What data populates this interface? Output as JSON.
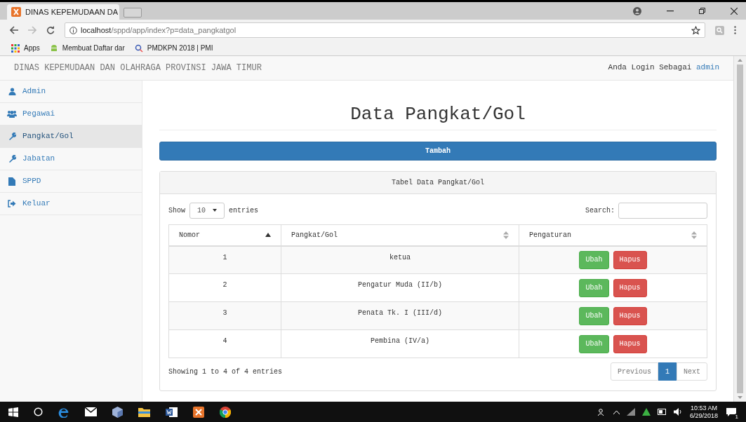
{
  "browser": {
    "tab_title": "DINAS KEPEMUDAAN DA",
    "url_host": "localhost",
    "url_path": "/sppd/app/index?p=data_pangkatgol",
    "bookmarks": [
      {
        "label": "Apps"
      },
      {
        "label": "Membuat Daftar dar"
      },
      {
        "label": "PMDKPN 2018 | PMI"
      }
    ]
  },
  "header": {
    "title": "DINAS KEPEMUDAAN DAN OLAHRAGA PROVINSI JAWA TIMUR",
    "login_text": "Anda Login Sebagai",
    "user": "admin"
  },
  "sidebar": {
    "items": [
      {
        "label": "Admin",
        "kind": "user",
        "selected": false
      },
      {
        "label": "Pegawai",
        "kind": "users",
        "selected": false
      },
      {
        "label": "Pangkat/Gol",
        "kind": "wrench",
        "selected": true
      },
      {
        "label": "Jabatan",
        "kind": "wrench",
        "selected": false
      },
      {
        "label": "SPPD",
        "kind": "file",
        "selected": false
      },
      {
        "label": "Keluar",
        "kind": "logout",
        "selected": false
      }
    ]
  },
  "page_title": "Data Pangkat/Gol",
  "add_button": "Tambah",
  "panel": {
    "title": "Tabel Data Pangkat/Gol",
    "show_label": "Show",
    "page_size": "10",
    "entries_label": "entries",
    "search_label": "Search:",
    "table": {
      "columns": [
        {
          "label": "Nomor",
          "kind": "sorted"
        },
        {
          "label": "Pangkat/Gol",
          "kind": "sortable"
        },
        {
          "label": "Pengaturan",
          "kind": "sortable"
        }
      ],
      "rows": [
        {
          "nomor": "1",
          "pangkat": "ketua",
          "actions": [
            {
              "label": "Ubah",
              "kind": "edit"
            },
            {
              "label": "Hapus",
              "kind": "delete"
            }
          ]
        },
        {
          "nomor": "2",
          "pangkat": "Pengatur Muda (II/b)",
          "actions": [
            {
              "label": "Ubah",
              "kind": "edit"
            },
            {
              "label": "Hapus",
              "kind": "delete"
            }
          ]
        },
        {
          "nomor": "3",
          "pangkat": "Penata Tk. I (III/d)",
          "actions": [
            {
              "label": "Ubah",
              "kind": "edit"
            },
            {
              "label": "Hapus",
              "kind": "delete"
            }
          ]
        },
        {
          "nomor": "4",
          "pangkat": "Pembina (IV/a)",
          "actions": [
            {
              "label": "Ubah",
              "kind": "edit"
            },
            {
              "label": "Hapus",
              "kind": "delete"
            }
          ]
        }
      ]
    },
    "info": "Showing 1 to 4 of 4 entries",
    "pagination": [
      {
        "label": "Previous",
        "selected": false
      },
      {
        "label": "1",
        "selected": true
      },
      {
        "label": "Next",
        "selected": false
      }
    ]
  },
  "taskbar": {
    "time": "10:53 AM",
    "date": "6/29/2018",
    "notification_count": "1"
  }
}
